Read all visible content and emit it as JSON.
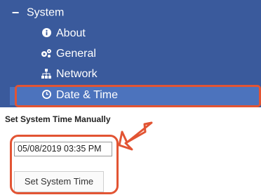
{
  "sidebar": {
    "parent": {
      "label": "System",
      "icon": "minus-icon"
    },
    "items": [
      {
        "label": "About",
        "icon": "info-circle-icon"
      },
      {
        "label": "General",
        "icon": "gears-icon"
      },
      {
        "label": "Network",
        "icon": "sitemap-icon"
      },
      {
        "label": "Date & Time",
        "icon": "clock-icon",
        "selected": true
      }
    ]
  },
  "main": {
    "section_title": "Set System Time Manually",
    "datetime_value": "05/08/2019 03:35 PM",
    "set_button_label": "Set System Time"
  },
  "colors": {
    "nav_bg": "#3a5a9c",
    "selected_bg": "#4c73bd",
    "highlight": "#e25433"
  }
}
